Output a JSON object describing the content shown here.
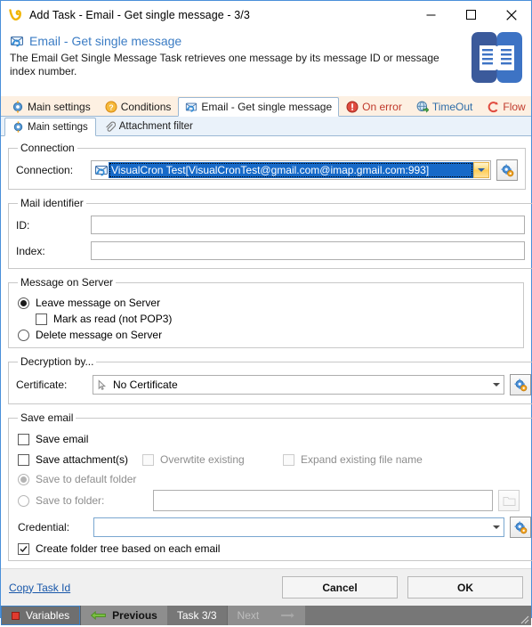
{
  "window": {
    "title": "Add Task - Email - Get single message - 3/3",
    "title_icon": "visualcron-v-logo-icon",
    "caption": {
      "minimize": "—",
      "maximize": "☐",
      "close": "✕"
    }
  },
  "header": {
    "icon": "email-get-message-icon",
    "title": "Email - Get single message",
    "description": "The Email Get Single Message Task retrieves one message by its message ID or message index number.",
    "logo_icon": "open-book-icon"
  },
  "tabs_primary": [
    {
      "label": "Main settings",
      "icon": "gear-blue-icon",
      "active": false,
      "color": "default"
    },
    {
      "label": "Conditions",
      "icon": "question-orange-icon",
      "active": false,
      "color": "default"
    },
    {
      "label": "Email - Get single message",
      "icon": "email-sync-icon",
      "active": true,
      "color": "default"
    },
    {
      "label": "On error",
      "icon": "error-red-icon",
      "active": false,
      "color": "red"
    },
    {
      "label": "TimeOut",
      "icon": "globe-green-arrow-icon",
      "active": false,
      "color": "blue"
    },
    {
      "label": "Flow",
      "icon": "flow-c-red-icon",
      "active": false,
      "color": "red"
    }
  ],
  "tabs_secondary": [
    {
      "label": "Main settings",
      "icon": "gear-blue-icon",
      "active": true
    },
    {
      "label": "Attachment filter",
      "icon": "paperclip-icon",
      "active": false
    }
  ],
  "connection_group": {
    "legend": "Connection",
    "label": "Connection:",
    "value": "VisualCron Test[VisualCronTest@gmail.com@imap.gmail.com:993]",
    "item_icon": "email-sync-icon",
    "dropdown_icon": "chevron-down-icon",
    "settings_button_icon": "gear-blue-orange-icon"
  },
  "mail_identifier_group": {
    "legend": "Mail identifier",
    "id_label": "ID:",
    "id_value": "",
    "index_label": "Index:",
    "index_value": ""
  },
  "message_on_server_group": {
    "legend": "Message on Server",
    "leave_label": "Leave message on Server",
    "leave_checked": true,
    "mark_read_label": "Mark as read (not POP3)",
    "mark_read_checked": false,
    "delete_label": "Delete message on Server",
    "delete_checked": false
  },
  "decryption_group": {
    "legend": "Decryption by...",
    "label": "Certificate:",
    "value": "No Certificate",
    "value_icon": "certificate-cursor-icon",
    "dropdown_icon": "chevron-down-icon",
    "settings_button_icon": "gear-blue-orange-icon"
  },
  "save_email_group": {
    "legend": "Save email",
    "save_email_label": "Save email",
    "save_email_checked": false,
    "save_attachments_label": "Save attachment(s)",
    "save_attachments_checked": false,
    "overwrite_label": "Overwtite existing",
    "overwrite_checked": false,
    "overwrite_disabled": true,
    "expand_label": "Expand existing file name",
    "expand_checked": false,
    "expand_disabled": true,
    "save_default_label": "Save to default folder",
    "save_default_checked": true,
    "save_default_disabled": true,
    "save_folder_label": "Save to folder:",
    "save_folder_checked": false,
    "save_folder_disabled": true,
    "save_folder_value": "",
    "browse_button_icon": "folder-icon",
    "credential_label": "Credential:",
    "credential_value": "",
    "credential_dropdown_icon": "chevron-down-icon",
    "credential_settings_icon": "gear-blue-orange-icon",
    "create_tree_label": "Create folder tree based on each email",
    "create_tree_checked": true
  },
  "footer": {
    "copy_task_id": "Copy Task Id",
    "cancel": "Cancel",
    "ok": "OK"
  },
  "statusbar": {
    "variables": "Variables",
    "variables_icon": "red-square-icon",
    "previous": "Previous",
    "previous_icon": "arrow-left-green-icon",
    "task_position": "Task 3/3",
    "next": "Next",
    "next_icon": "arrow-right-gray-icon",
    "grip_icon": "resize-grip-icon"
  },
  "colors": {
    "window_border": "#4a90d9",
    "header_title": "#3b7cc4",
    "tabstrip_bg": "#fdf0e2",
    "selection_blue": "#1669c8",
    "statusbar_bg": "#777777",
    "link": "#1756a9",
    "tab_red": "#c0392b"
  }
}
